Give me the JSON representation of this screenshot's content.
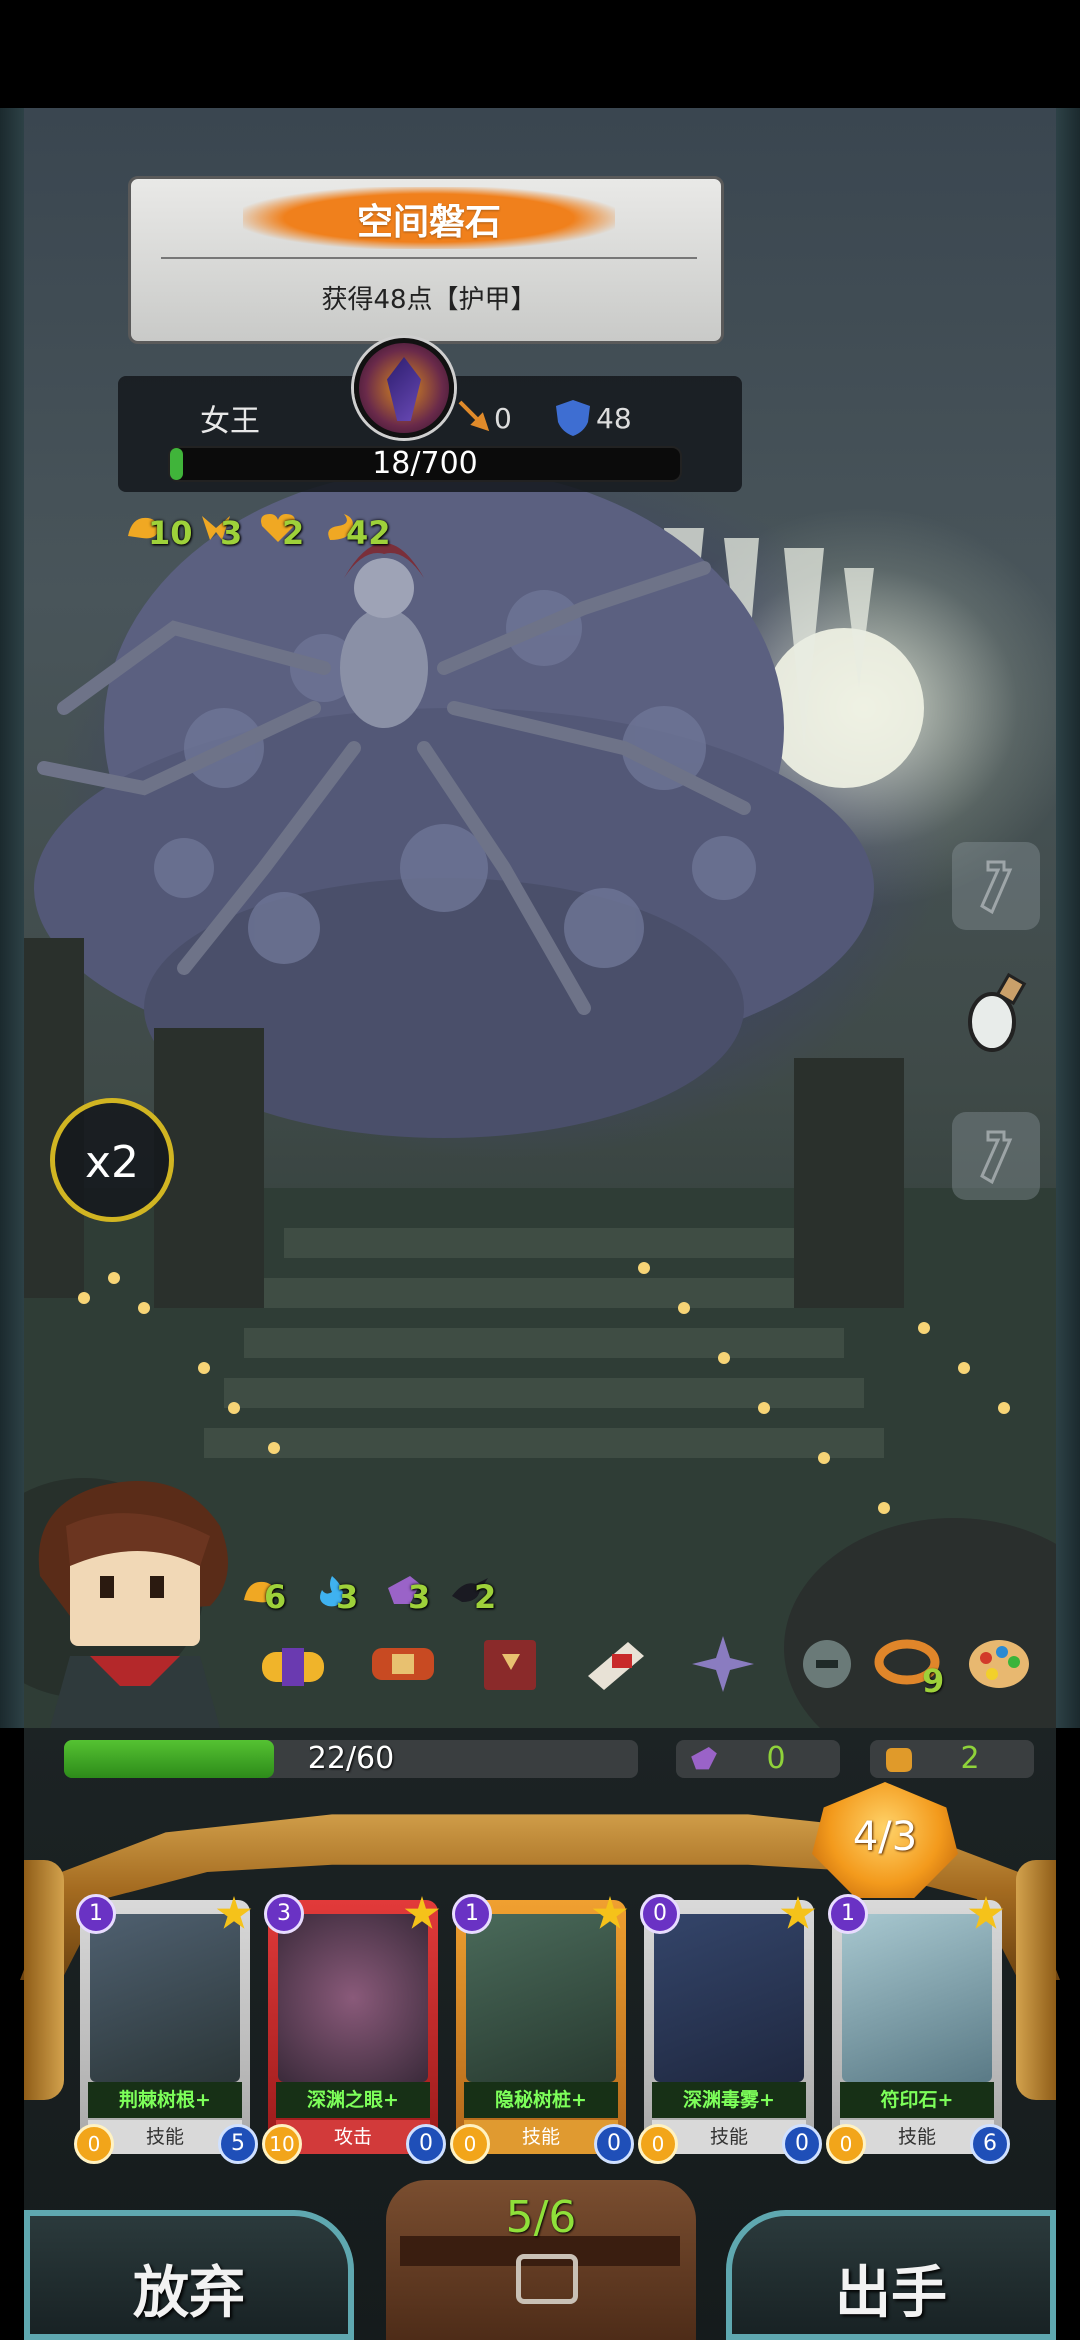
{
  "skill": {
    "title": "空间磐石",
    "description": "获得48点【护甲】"
  },
  "enemy": {
    "name": "女王",
    "attack": "0",
    "armor": "48",
    "hp_text": "18/700",
    "hp_current": 18,
    "hp_max": 700,
    "buffs": [
      {
        "icon": "strength-buff-icon",
        "value": "10"
      },
      {
        "icon": "ribbon-buff-icon",
        "value": "3"
      },
      {
        "icon": "heart-buff-icon",
        "value": "2"
      },
      {
        "icon": "serpent-buff-icon",
        "value": "42"
      }
    ]
  },
  "speed": {
    "label": "x2"
  },
  "potions": [
    "empty-potion-slot",
    "potion-flask-icon",
    "empty-potion-slot"
  ],
  "player": {
    "hp_text": "22/60",
    "hp_current": 22,
    "hp_max": 60,
    "shield": "0",
    "fist": "2",
    "buffs": [
      {
        "icon": "strength-buff-icon",
        "value": "6"
      },
      {
        "icon": "blue-flame-icon",
        "value": "3"
      },
      {
        "icon": "purple-shield-icon",
        "value": "3"
      },
      {
        "icon": "crow-icon",
        "value": "2"
      }
    ],
    "relics": [
      {
        "icon": "scroll-relic-icon",
        "value": ""
      },
      {
        "icon": "belt-relic-icon",
        "value": ""
      },
      {
        "icon": "book-relic-icon",
        "value": ""
      },
      {
        "icon": "boot-relic-icon",
        "value": ""
      },
      {
        "icon": "shuriken-relic-icon",
        "value": ""
      },
      {
        "icon": "helmet-relic-icon",
        "value": ""
      },
      {
        "icon": "ring-relic-icon",
        "value": "9"
      },
      {
        "icon": "palette-relic-icon",
        "value": ""
      }
    ]
  },
  "energy": "4/3",
  "cards": [
    {
      "cost": "1",
      "name": "荆棘树根+",
      "type": "技能",
      "left": "0",
      "right": "5",
      "kind": "skill"
    },
    {
      "cost": "3",
      "name": "深渊之眼+",
      "type": "攻击",
      "left": "10",
      "right": "0",
      "kind": "attack"
    },
    {
      "cost": "1",
      "name": "隐秘树桩+",
      "type": "技能",
      "left": "0",
      "right": "0",
      "kind": "power"
    },
    {
      "cost": "0",
      "name": "深渊毒雾+",
      "type": "技能",
      "left": "0",
      "right": "0",
      "kind": "skill"
    },
    {
      "cost": "1",
      "name": "符印石+",
      "type": "技能",
      "left": "0",
      "right": "6",
      "kind": "skill"
    }
  ],
  "deck": "5/6",
  "buttons": {
    "discard": "放弃",
    "play": "出手"
  },
  "colors": {
    "hp_green": "#40b43a",
    "accent_gold": "#d1b522",
    "value_green": "#8fd23a",
    "energy_orange": "#f39a1c"
  }
}
